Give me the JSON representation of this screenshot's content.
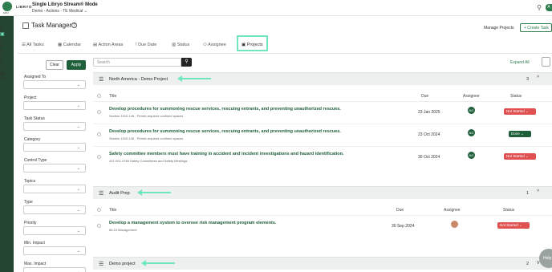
{
  "header": {
    "brand": "LIBRYO",
    "logo_sub": "ERM",
    "app_title": "Single Libryo Stream® Mode",
    "app_sub": "Demo - Actions - TE Medical",
    "app_sub_caret": "⌄",
    "avatar": "A"
  },
  "page": {
    "title": "Task Manager",
    "help": "?",
    "manage_projects": "Manage Projects",
    "create_task": "+ Create Task"
  },
  "tabs": [
    {
      "label": "All Tasks",
      "icon": "☰"
    },
    {
      "label": "Calendar",
      "icon": "▦"
    },
    {
      "label": "Action Areas",
      "icon": "▤"
    },
    {
      "label": "Due Date",
      "icon": "!"
    },
    {
      "label": "Status",
      "icon": "▥"
    },
    {
      "label": "Assignee",
      "icon": "⚇"
    },
    {
      "label": "Projects",
      "icon": "▣"
    }
  ],
  "filters": {
    "clear": "Clear",
    "apply": "Apply",
    "fields": [
      "Assigned To",
      "Project",
      "Task Status",
      "Category",
      "Control Type",
      "Topics",
      "Type",
      "Priority",
      "Min. Impact",
      "Max. Impact"
    ]
  },
  "main": {
    "search_placeholder": "Search",
    "expand_all": "Expand All",
    "col_title": "Title",
    "col_due": "Due",
    "col_assignee": "Assignee",
    "col_status": "Status"
  },
  "groups": [
    {
      "name": "North America - Demo Project",
      "count": "3",
      "caret": "^",
      "rows": [
        {
          "title": "Develop procedures for summoning rescue services, rescuing entrants, and preventing unauthorized rescues.",
          "sub": "Section 1910.146 - Permit-required confined spaces",
          "due": "23 Jan 2025",
          "assignee": "NG",
          "status": "Not Started",
          "status_color": "#e05252"
        },
        {
          "title": "Develop procedures for summoning rescue services, rescuing entrants, and preventing unauthorized rescues.",
          "sub": "Section 1910.146 - Permit-required confined spaces",
          "due": "23 Oct 2024",
          "assignee": "NG",
          "status": "Done",
          "status_color": "#1f5f3a"
        },
        {
          "title": "Safety committee members must have training in accident and incident investigations and hazard identification.",
          "sub": "437-001-0765 Safety Committees and Safety Meetings",
          "due": "30 Oct 2024",
          "assignee": "NG",
          "status": "Not Started",
          "status_color": "#e05252"
        }
      ]
    },
    {
      "name": "Audit Prep",
      "count": "1",
      "caret": "^",
      "rows": [
        {
          "title": "Develop a management system to oversee risk management program elements.",
          "sub": "68.15 Management",
          "due": "30 Sep 2024",
          "assignee": "",
          "status": "Not Started",
          "status_color": "#e05252"
        }
      ]
    },
    {
      "name": "Demo project",
      "count": "2",
      "caret": "v",
      "rows": []
    }
  ],
  "help_fab": "Help",
  "colors": {
    "accent": "#6fe6c0",
    "brand": "#1f5f3a",
    "danger": "#e05252"
  }
}
